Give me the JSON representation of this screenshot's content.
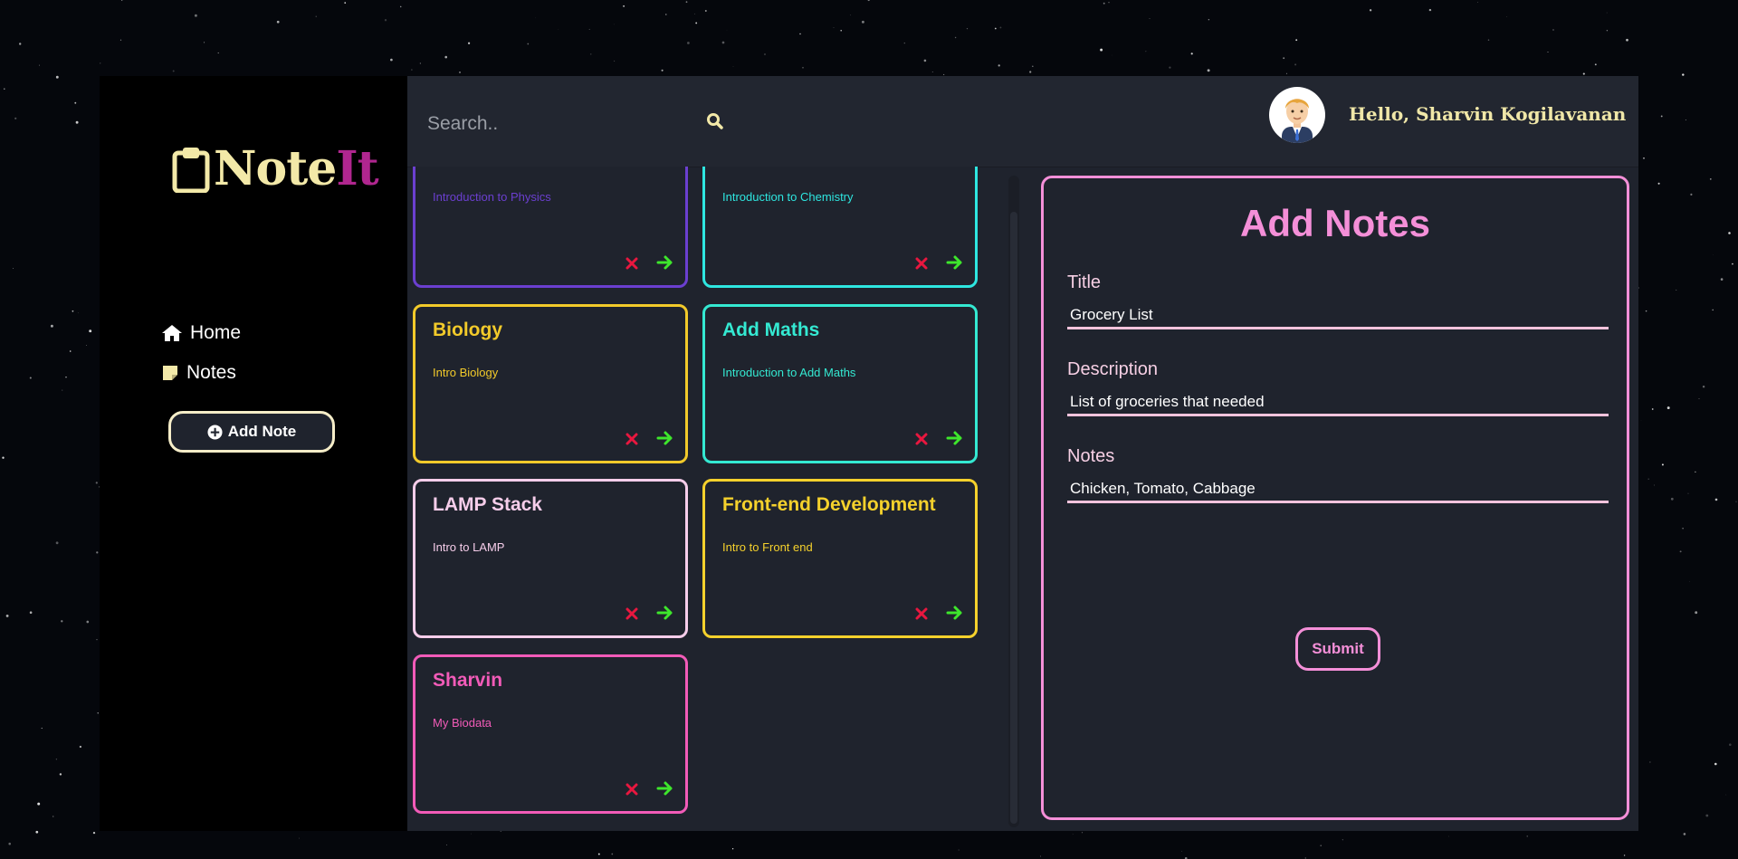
{
  "app": {
    "logo_main": "Note",
    "logo_accent": "It"
  },
  "sidebar": {
    "items": [
      {
        "label": "Home",
        "icon": "home-icon"
      },
      {
        "label": "Notes",
        "icon": "sticky-note-icon"
      }
    ],
    "add_button": "Add Note"
  },
  "header": {
    "search_placeholder": "Search..",
    "greeting": "Hello, Sharvin Kogilavanan"
  },
  "notes": [
    {
      "title": "",
      "desc": "Introduction to Physics",
      "color": "#6b3fd0"
    },
    {
      "title": "",
      "desc": "Introduction to Chemistry",
      "color": "#2ee6e0"
    },
    {
      "title": "Biology",
      "desc": "Intro Biology",
      "color": "#f2ca2a"
    },
    {
      "title": "Add Maths",
      "desc": "Introduction to Add Maths",
      "color": "#34e9d2"
    },
    {
      "title": "LAMP Stack",
      "desc": "Intro to LAMP",
      "color": "#f6cdea"
    },
    {
      "title": "Front-end Development",
      "desc": "Intro to Front end",
      "color": "#f5d12c"
    },
    {
      "title": "Sharvin",
      "desc": "My Biodata",
      "color": "#f25bb8"
    }
  ],
  "form": {
    "heading": "Add Notes",
    "title_label": "Title",
    "title_value": "Grocery List",
    "description_label": "Description",
    "description_value": "List of groceries that needed",
    "notes_label": "Notes",
    "notes_value": "Chicken, Tomato, Cabbage",
    "submit_label": "Submit"
  },
  "colors": {
    "delete": "#e8173f",
    "open": "#3ee62c",
    "accent": "#f48fd8",
    "logo": "#f3e9a8"
  }
}
